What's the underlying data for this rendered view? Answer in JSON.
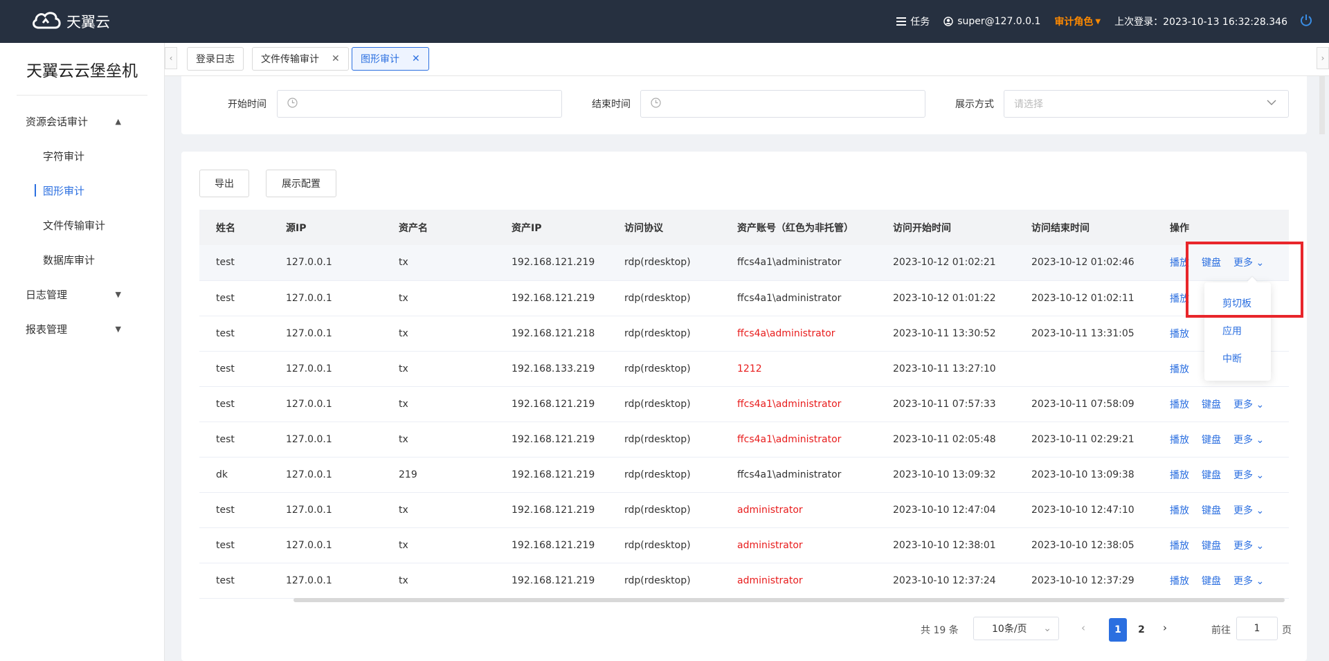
{
  "topbar": {
    "logo_text": "天翼云",
    "task": "任务",
    "user": "super@127.0.0.1",
    "role": "审计角色",
    "last_login": "上次登录：2023-10-13 16:32:28.346"
  },
  "sidebar": {
    "brand": "天翼云云堡垒机",
    "menu": {
      "session_audit": "资源会话审计",
      "char_audit": "字符审计",
      "graphic_audit": "图形审计",
      "file_audit": "文件传输审计",
      "db_audit": "数据库审计",
      "log_mgmt": "日志管理",
      "report_mgmt": "报表管理"
    }
  },
  "tabs": {
    "login_log": "登录日志",
    "file_audit": "文件传输审计",
    "graphic_audit": "图形审计"
  },
  "filters": {
    "start_label": "开始时间",
    "end_label": "结束时间",
    "display_label": "展示方式",
    "display_placeholder": "请选择"
  },
  "toolbar": {
    "export": "导出",
    "display_config": "展示配置"
  },
  "table": {
    "headers": [
      "姓名",
      "源IP",
      "资产名",
      "资产IP",
      "访问协议",
      "资产账号（红色为非托管）",
      "访问开始时间",
      "访问结束时间",
      "操作"
    ],
    "op_play": "播放",
    "op_keyboard": "键盘",
    "op_more": "更多",
    "rows": [
      {
        "name": "test",
        "src_ip": "127.0.0.1",
        "asset": "tx",
        "asset_ip": "192.168.121.219",
        "protocol": "rdp(rdesktop)",
        "account": "ffcs4a1\\administrator",
        "start": "2023-10-12 01:02:21",
        "end": "2023-10-12 01:02:46"
      },
      {
        "name": "test",
        "src_ip": "127.0.0.1",
        "asset": "tx",
        "asset_ip": "192.168.121.219",
        "protocol": "rdp(rdesktop)",
        "account": "ffcs4a1\\administrator",
        "start": "2023-10-12 01:01:22",
        "end": "2023-10-12 01:02:11"
      },
      {
        "name": "test",
        "src_ip": "127.0.0.1",
        "asset": "tx",
        "asset_ip": "192.168.121.218",
        "protocol": "rdp(rdesktop)",
        "account": "ffcs4a\\administrator",
        "start": "2023-10-11 13:30:52",
        "end": "2023-10-11 13:31:05"
      },
      {
        "name": "test",
        "src_ip": "127.0.0.1",
        "asset": "tx",
        "asset_ip": "192.168.133.219",
        "protocol": "rdp(rdesktop)",
        "account": "1212",
        "start": "2023-10-11 13:27:10",
        "end": ""
      },
      {
        "name": "test",
        "src_ip": "127.0.0.1",
        "asset": "tx",
        "asset_ip": "192.168.121.219",
        "protocol": "rdp(rdesktop)",
        "account": "ffcs4a1\\administrator",
        "start": "2023-10-11 07:57:33",
        "end": "2023-10-11 07:58:09"
      },
      {
        "name": "test",
        "src_ip": "127.0.0.1",
        "asset": "tx",
        "asset_ip": "192.168.121.219",
        "protocol": "rdp(rdesktop)",
        "account": "ffcs4a1\\administrator",
        "start": "2023-10-11 02:05:48",
        "end": "2023-10-11 02:29:21"
      },
      {
        "name": "dk",
        "src_ip": "127.0.0.1",
        "asset": "219",
        "asset_ip": "192.168.121.219",
        "protocol": "rdp(rdesktop)",
        "account": "ffcs4a1\\administrator",
        "start": "2023-10-10 13:09:32",
        "end": "2023-10-10 13:09:38"
      },
      {
        "name": "test",
        "src_ip": "127.0.0.1",
        "asset": "tx",
        "asset_ip": "192.168.121.219",
        "protocol": "rdp(rdesktop)",
        "account": "administrator",
        "start": "2023-10-10 12:47:04",
        "end": "2023-10-10 12:47:10"
      },
      {
        "name": "test",
        "src_ip": "127.0.0.1",
        "asset": "tx",
        "asset_ip": "192.168.121.219",
        "protocol": "rdp(rdesktop)",
        "account": "administrator",
        "start": "2023-10-10 12:38:01",
        "end": "2023-10-10 12:38:05"
      },
      {
        "name": "test",
        "src_ip": "127.0.0.1",
        "asset": "tx",
        "asset_ip": "192.168.121.219",
        "protocol": "rdp(rdesktop)",
        "account": "administrator",
        "start": "2023-10-10 12:37:24",
        "end": "2023-10-10 12:37:29"
      }
    ]
  },
  "dropdown": {
    "clipboard": "剪切板",
    "app": "应用",
    "interrupt": "中断"
  },
  "pagination": {
    "total": "共 19 条",
    "page_size": "10条/页",
    "page1": "1",
    "page2": "2",
    "goto_label": "前往",
    "goto_value": "1",
    "page_suffix": "页"
  },
  "colors": {
    "topbar": "#263040",
    "accent": "#2b6fe0",
    "role": "#ff8a00",
    "unmanaged": "#e81c1c",
    "highlight": "#e8262b"
  }
}
